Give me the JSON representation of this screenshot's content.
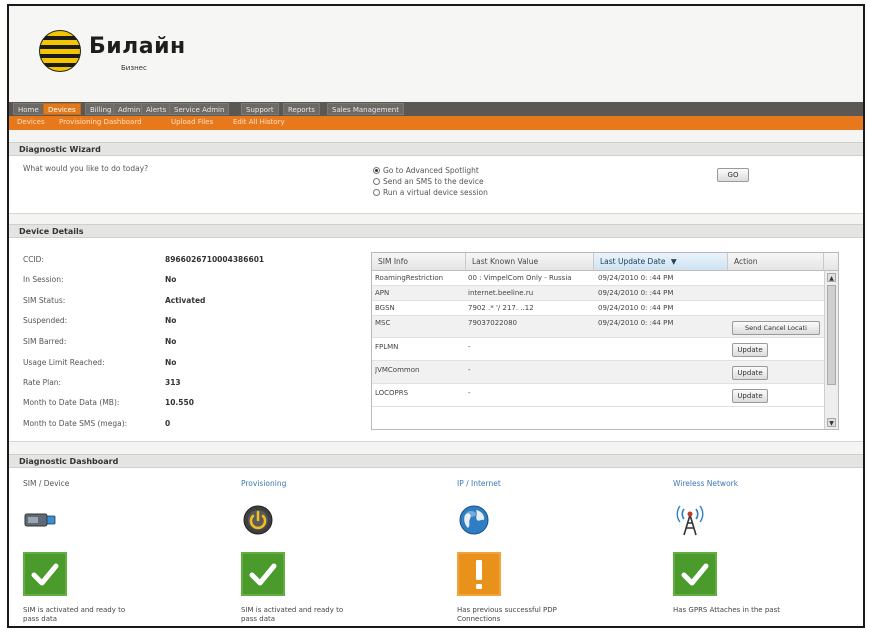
{
  "brand": {
    "name": "Билайн",
    "subtitle": "Бизнес"
  },
  "nav": {
    "items": [
      {
        "label": "Home",
        "active": false
      },
      {
        "label": "Devices",
        "active": true
      },
      {
        "label": "Billing",
        "active": false
      },
      {
        "label": "Admin",
        "active": false
      },
      {
        "label": "Alerts",
        "active": false
      },
      {
        "label": "Service Admin",
        "active": false
      },
      {
        "label": "Support",
        "active": false
      },
      {
        "label": "Reports",
        "active": false
      },
      {
        "label": "Sales Management",
        "active": false
      }
    ],
    "subitems": [
      "Devices",
      "Provisioning Dashboard",
      "Upload Files",
      "Edit All History"
    ]
  },
  "wizard": {
    "title": "Diagnostic Wizard",
    "question": "What would you like to do today?",
    "options": [
      {
        "label": "Go to Advanced Spotlight",
        "selected": true
      },
      {
        "label": "Send an SMS to the device",
        "selected": false
      },
      {
        "label": "Run a virtual device session",
        "selected": false
      }
    ],
    "go_label": "GO"
  },
  "device": {
    "title": "Device Details",
    "fields": [
      {
        "label": "CCID:",
        "value": "8966026710004386601"
      },
      {
        "label": "In Session:",
        "value": "No"
      },
      {
        "label": "SIM Status:",
        "value": "Activated"
      },
      {
        "label": "Suspended:",
        "value": "No"
      },
      {
        "label": "SIM Barred:",
        "value": "No"
      },
      {
        "label": "Usage Limit Reached:",
        "value": "No"
      },
      {
        "label": "Rate Plan:",
        "value": "313"
      },
      {
        "label": "Month to Date Data (MB):",
        "value": "10.550"
      },
      {
        "label": "Month to Date SMS (mega):",
        "value": "0"
      }
    ]
  },
  "siminfo": {
    "headers": [
      "SIM Info",
      "Last Known Value",
      "Last Update Date",
      "Action"
    ],
    "sort_indicator": "▼",
    "rows": [
      {
        "info": "RoamingRestriction",
        "value": "00 : VimpelCom Only - Russia",
        "date": "09/24/2010 0: :44 PM",
        "action": ""
      },
      {
        "info": "APN",
        "value": "internet.beeline.ru",
        "date": "09/24/2010 0: :44 PM",
        "action": ""
      },
      {
        "info": "BGSN",
        "value": "7902 .* '/ 217. ..12",
        "date": "09/24/2010 0: :44 PM",
        "action": ""
      },
      {
        "info": "MSC",
        "value": "79037022080",
        "date": "09/24/2010 0: :44 PM",
        "action": "Send Cancel Locati"
      },
      {
        "info": "FPLMN",
        "value": "-",
        "date": "",
        "action": "Update"
      },
      {
        "info": "JVMCommon",
        "value": "-",
        "date": "",
        "action": "Update"
      },
      {
        "info": "LOCOPRS",
        "value": "-",
        "date": "",
        "action": "Update"
      }
    ]
  },
  "dashboard": {
    "title": "Diagnostic Dashboard",
    "columns": [
      {
        "heading": "SIM / Device",
        "icon": "sim-card-icon",
        "status": "ok",
        "description": "SIM is activated and ready to pass data",
        "heading_color": "#555555"
      },
      {
        "heading": "Provisioning",
        "icon": "power-icon",
        "status": "ok",
        "description": "SIM is activated and ready to pass data",
        "heading_color": "#3a78b5"
      },
      {
        "heading": "IP / Internet",
        "icon": "globe-icon",
        "status": "warning",
        "description": "Has previous successful PDP Connections",
        "heading_color": "#3a78b5"
      },
      {
        "heading": "Wireless Network",
        "icon": "antenna-icon",
        "status": "ok",
        "description": "Has GPRS Attaches in the past",
        "heading_color": "#3a78b5"
      }
    ]
  },
  "colors": {
    "accent_orange": "#e8781c",
    "ok_green": "#4a9a2c",
    "warning_orange": "#e8921c",
    "link_blue": "#3a78b5"
  }
}
